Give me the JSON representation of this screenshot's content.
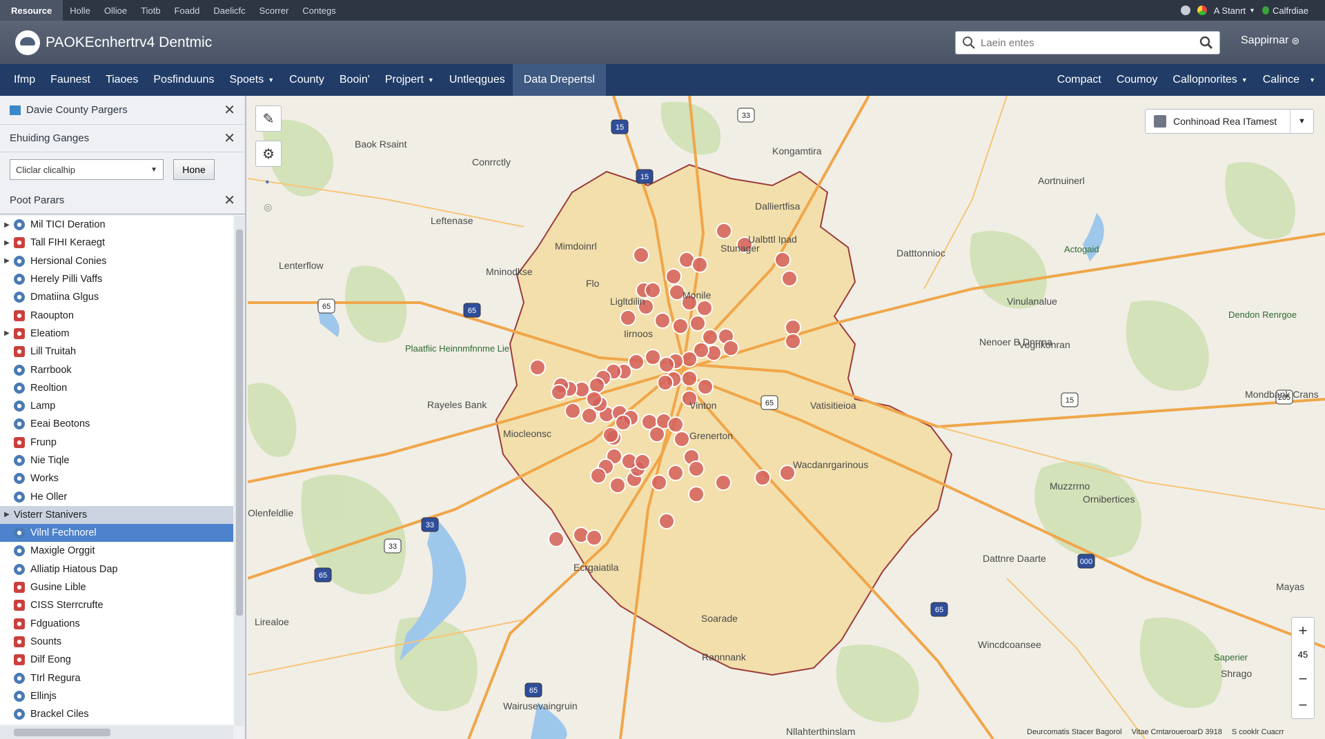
{
  "topbar": {
    "brand": "Resource",
    "links": [
      "Holle",
      "Ollioe",
      "Tiotb",
      "Foadd",
      "Daelicfc",
      "Scorrer",
      "Contegs"
    ],
    "user": "A Stanrt",
    "calendar": "Calfrdiae"
  },
  "header": {
    "title": "PAOKEcnhertrv4 Dentmic",
    "search_placeholder": "Laein entes",
    "user": "Sappirnar"
  },
  "nav": {
    "items": [
      "Ifmp",
      "Faunest",
      "Tiaoes",
      "Posfinduuns",
      "Spoets",
      "County",
      "Booin'",
      "Projpert",
      "Untleqgues",
      "Data Drepertsl"
    ],
    "right": [
      "Compact",
      "Coumoy",
      "Callopnorites",
      "Calince"
    ],
    "active": "Data Drepertsl"
  },
  "panel": {
    "title": "Davie County Pargers",
    "section1": "Ehuiding Ganges",
    "select_value": "Cliclar clicalhip",
    "home": "Hone",
    "section2": "Poot Parars",
    "items": [
      {
        "label": "Mil TICI Deration",
        "exp": "▶",
        "icon": "blue"
      },
      {
        "label": "Tall FIHI Keraegt",
        "exp": "▶",
        "icon": "red"
      },
      {
        "label": "Hersional Conies",
        "exp": "▶",
        "icon": "blue"
      },
      {
        "label": "Herely Pilli Vaffs",
        "exp": "",
        "icon": "blue"
      },
      {
        "label": "Dmatiina Glgus",
        "exp": "",
        "icon": "blue"
      },
      {
        "label": "Raoupton",
        "exp": "",
        "icon": "red"
      },
      {
        "label": "Eleatiom",
        "exp": "▶",
        "icon": "red"
      },
      {
        "label": "Lill Truitah",
        "exp": "",
        "icon": "red"
      },
      {
        "label": "Rarrbook",
        "exp": "",
        "icon": "blue"
      },
      {
        "label": "Reoltion",
        "exp": "",
        "icon": "blue"
      },
      {
        "label": "Lamp",
        "exp": "",
        "icon": "blue"
      },
      {
        "label": "Eeai Beotons",
        "exp": "",
        "icon": "blue"
      },
      {
        "label": "Frunp",
        "exp": "",
        "icon": "red"
      },
      {
        "label": "Nie Tiqle",
        "exp": "",
        "icon": "blue"
      },
      {
        "label": "Works",
        "exp": "",
        "icon": "blue"
      },
      {
        "label": "He Oller",
        "exp": "",
        "icon": "blue"
      },
      {
        "label": "Visterr Stanivers",
        "exp": "▶",
        "icon": "",
        "group": true
      },
      {
        "label": "Vilnl Fechnorel",
        "exp": "",
        "icon": "blue",
        "selected": true
      },
      {
        "label": "Maxigle Orggit",
        "exp": "",
        "icon": "blue"
      },
      {
        "label": "Alliatip Hiatous Dap",
        "exp": "",
        "icon": "blue"
      },
      {
        "label": "Gusine Lible",
        "exp": "",
        "icon": "red"
      },
      {
        "label": "CISS Sterrcrufte",
        "exp": "",
        "icon": "red"
      },
      {
        "label": "Fdguations",
        "exp": "",
        "icon": "red"
      },
      {
        "label": "Sounts",
        "exp": "",
        "icon": "red"
      },
      {
        "label": "Dilf Eong",
        "exp": "",
        "icon": "red"
      },
      {
        "label": "TIrl Regura",
        "exp": "",
        "icon": "blue"
      },
      {
        "label": "Ellinjs",
        "exp": "",
        "icon": "blue"
      },
      {
        "label": "Brackel Ciles",
        "exp": "",
        "icon": "blue"
      }
    ]
  },
  "map": {
    "download": "Conhinoad Rea ITamest",
    "zoom_level": "45",
    "attribution": [
      "Deurcomatis Stacer Bagorol",
      "Vitae CmtaroueroarD 3918",
      "S cooklr Cuacrr"
    ],
    "places": [
      "Baok Rsaint",
      "Conrrctly",
      "Kongamtira",
      "Dalliertfisa",
      "Leftenase",
      "Mimdoinrl",
      "Stunager",
      "Ualbttl Ipad",
      "Datttonnioc",
      "Lenterflow",
      "Mninodkse",
      "Flo",
      "Monile",
      "Vinulanalue",
      "Ligltdilin",
      "Iirnoos",
      "Nenoer B Dnrrna",
      "Vognkonran",
      "Plaatfiic Heinnmfnnme Lie",
      "Rayeles Bank",
      "Vinton",
      "Vatisitieioa",
      "Miocleonsc",
      "Grenerton",
      "Wacdanrgarinous",
      "Muzzrrno",
      "Olenfeldlie",
      "Ornibertices",
      "Dattnre Daarte",
      "Ecrgaiatila",
      "Mayas",
      "Mondbank Crans",
      "Lirealoe",
      "Soarade",
      "Wincdcoansee",
      "Saperier",
      "Shrago",
      "Wairusevaingruin",
      "Rannnank",
      "Nllahterthinslam",
      "Actogaid",
      "Dendon Renrgoe",
      "Aortnuinerl"
    ],
    "shields": [
      "33",
      "15",
      "15",
      "65",
      "65",
      "15",
      "65",
      "65",
      "33",
      "33",
      "65",
      "65",
      "15",
      "15",
      "000",
      "205"
    ]
  }
}
